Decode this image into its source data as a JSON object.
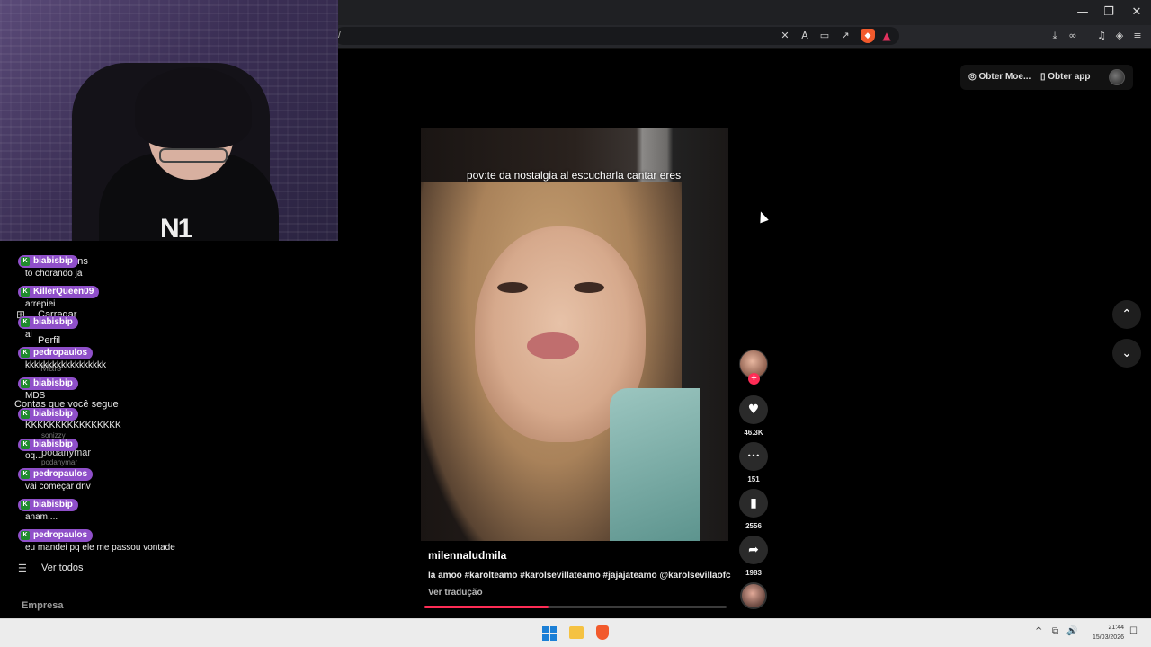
{
  "browser": {
    "window_controls": [
      "—",
      "❐",
      "✕"
    ],
    "url_fragment": "/",
    "toolbar_icons_left": [
      "translate-off-icon",
      "translate-icon",
      "cast-icon",
      "share-icon",
      "brave-shield-icon",
      "brave-rewards-icon"
    ],
    "toolbar_icons_right": [
      "download-icon",
      "link-icon",
      "music-icon",
      "vpn-icon",
      "menu-icon"
    ]
  },
  "tiktok_sidebar_ghost": {
    "items": [
      "gens",
      "Carregar",
      "Perfil",
      "Mais"
    ],
    "following_title": "Contas que você segue",
    "following": [
      {
        "name": "podanymar",
        "handle": "podanymar"
      },
      {
        "name": "",
        "handle": "sonizzy"
      }
    ],
    "see_all": "Ver todos",
    "company": "Empresa"
  },
  "chat": {
    "messages": [
      {
        "user": "biabisbip",
        "text": "to chorando ja"
      },
      {
        "user": "KillerQueen09",
        "text": "arrepiei"
      },
      {
        "user": "biabisbip",
        "text": "ai"
      },
      {
        "user": "pedropaulos",
        "text": "kkkkkkkkkkkkkkkkkk"
      },
      {
        "user": "biabisbip",
        "text": "MDS"
      },
      {
        "user": "biabisbip",
        "text": "KKKKKKKKKKKKKKKK"
      },
      {
        "user": "biabisbip",
        "text": "oq..."
      },
      {
        "user": "pedropaulos",
        "text": "vai começar dnv"
      },
      {
        "user": "biabisbip",
        "text": "anam,..."
      },
      {
        "user": "pedropaulos",
        "text": "eu mandei pq ele me passou vontade"
      }
    ]
  },
  "header_actions": {
    "coins": "Obter Moe...",
    "app": "Obter app"
  },
  "video": {
    "caption": "pov:te da nostalgia al escucharla cantar eres",
    "author": "milennaludmila",
    "description": "la amoo #karolteamo #karolsevillateamo #jajajateamo @karolsevillaofc",
    "translate": "Ver tradução",
    "progress": 0.41
  },
  "actions": {
    "likes": "46.3K",
    "comments": "151",
    "saves": "2556",
    "shares": "1983",
    "follow_symbol": "+",
    "like_icon": "♥",
    "comment_icon": "•••",
    "save_icon": "▮",
    "share_icon": "➦"
  },
  "nav": {
    "up": "⌃",
    "down": "⌄"
  },
  "taskbar": {
    "time": "21:44",
    "date": "15/03/2026",
    "tray": [
      "^",
      "⧉",
      "🔊",
      "☐"
    ]
  },
  "colors": {
    "accent": "#fe2c55",
    "chat_badge": "#8f4fc9"
  }
}
